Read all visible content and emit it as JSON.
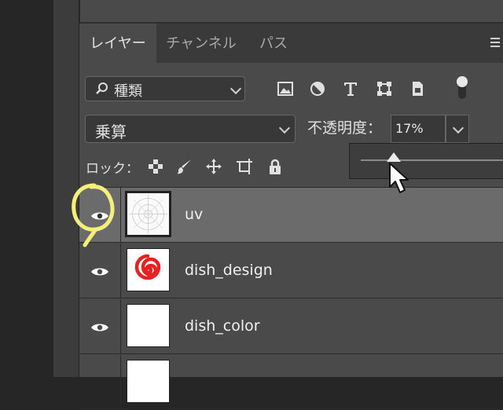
{
  "tabs": [
    {
      "label": "レイヤー",
      "active": true
    },
    {
      "label": "チャンネル",
      "active": false
    },
    {
      "label": "パス",
      "active": false
    }
  ],
  "filter": {
    "label": "種類"
  },
  "blend": {
    "mode": "乗算"
  },
  "opacity": {
    "label": "不透明度：",
    "value": "17%",
    "slider_fraction": 0.17
  },
  "lock": {
    "label": "ロック："
  },
  "layers": [
    {
      "name": "uv",
      "visible": true,
      "selected": true,
      "thumb": "uv-grid"
    },
    {
      "name": "dish_design",
      "visible": true,
      "selected": false,
      "thumb": "red-spiral"
    },
    {
      "name": "dish_color",
      "visible": true,
      "selected": false,
      "thumb": "white"
    },
    {
      "name": "",
      "visible": false,
      "selected": false,
      "thumb": "white"
    }
  ],
  "icons": {
    "filter_icons": [
      "image-filter-icon",
      "adjustment-filter-icon",
      "type-filter-icon",
      "shape-filter-icon",
      "smart-object-filter-icon"
    ],
    "lock_icons": [
      "lock-transparent-pixels-icon",
      "lock-image-pixels-icon",
      "lock-position-icon",
      "lock-artboard-icon",
      "lock-all-icon"
    ]
  },
  "colors": {
    "annotation_circle": "#f4ee7a",
    "spiral": "#e8201f",
    "selected_row": "#6b6b6b"
  }
}
